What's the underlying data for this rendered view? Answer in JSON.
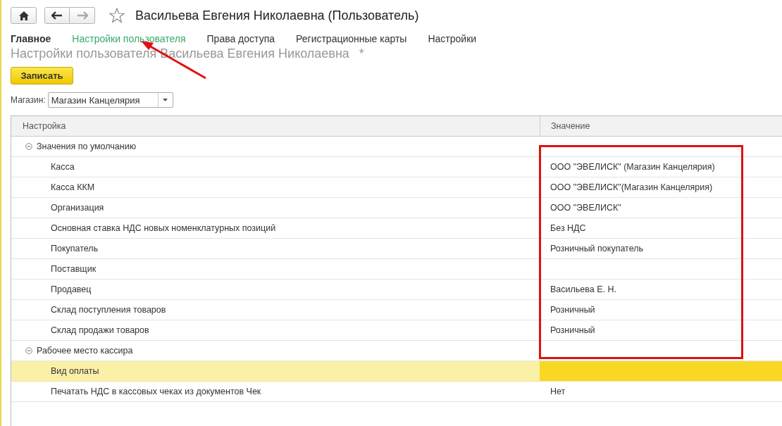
{
  "nav": {
    "favorite": false,
    "back_disabled": false,
    "forward_disabled": true
  },
  "window": {
    "title": "Васильева Евгения Николаевна (Пользователь)"
  },
  "tabs": [
    {
      "label": "Главное",
      "selected": true,
      "hovered": false
    },
    {
      "label": "Настройки пользователя",
      "selected": false,
      "hovered": true
    },
    {
      "label": "Права доступа",
      "selected": false,
      "hovered": false
    },
    {
      "label": "Регистрационные карты",
      "selected": false,
      "hovered": false
    },
    {
      "label": "Настройки",
      "selected": false,
      "hovered": false
    }
  ],
  "form": {
    "title": "Настройки пользователя Васильева Евгения Николаевна",
    "modified_mark": "*",
    "save_button": "Записать",
    "store_label": "Магазин:",
    "store_value": "Магазин Канцелярия"
  },
  "table": {
    "columns": [
      "Настройка",
      "Значение"
    ],
    "groups": [
      {
        "label": "Значения по умолчанию",
        "expanded": true,
        "children": [
          {
            "label": "Касса",
            "value": "ООО \"ЭВЕЛИСК\" (Магазин Канцелярия)",
            "selected": false
          },
          {
            "label": "Касса ККМ",
            "value": "ООО \"ЭВЕЛИСК\"(Магазин Канцелярия)",
            "selected": false
          },
          {
            "label": "Организация",
            "value": "ООО \"ЭВЕЛИСК\"",
            "selected": false
          },
          {
            "label": "Основная ставка НДС новых номенклатурных позиций",
            "value": "Без НДС",
            "selected": false
          },
          {
            "label": "Покупатель",
            "value": "Розничный покупатель",
            "selected": false
          },
          {
            "label": "Поставщик",
            "selected": false
          },
          {
            "label": "Продавец",
            "value": "Васильева Е. Н.",
            "selected": false
          },
          {
            "label": "Склад поступления товаров",
            "value": "Розничный",
            "selected": false
          },
          {
            "label": "Склад продажи товаров",
            "value": "Розничный",
            "selected": false
          }
        ]
      },
      {
        "label": "Рабочее место кассира",
        "expanded": true,
        "children": [
          {
            "label": "Вид оплаты",
            "selected": true
          },
          {
            "label": "Печатать НДС в кассовых чеках из документов Чек",
            "value": "Нет",
            "selected": false
          }
        ]
      }
    ]
  }
}
